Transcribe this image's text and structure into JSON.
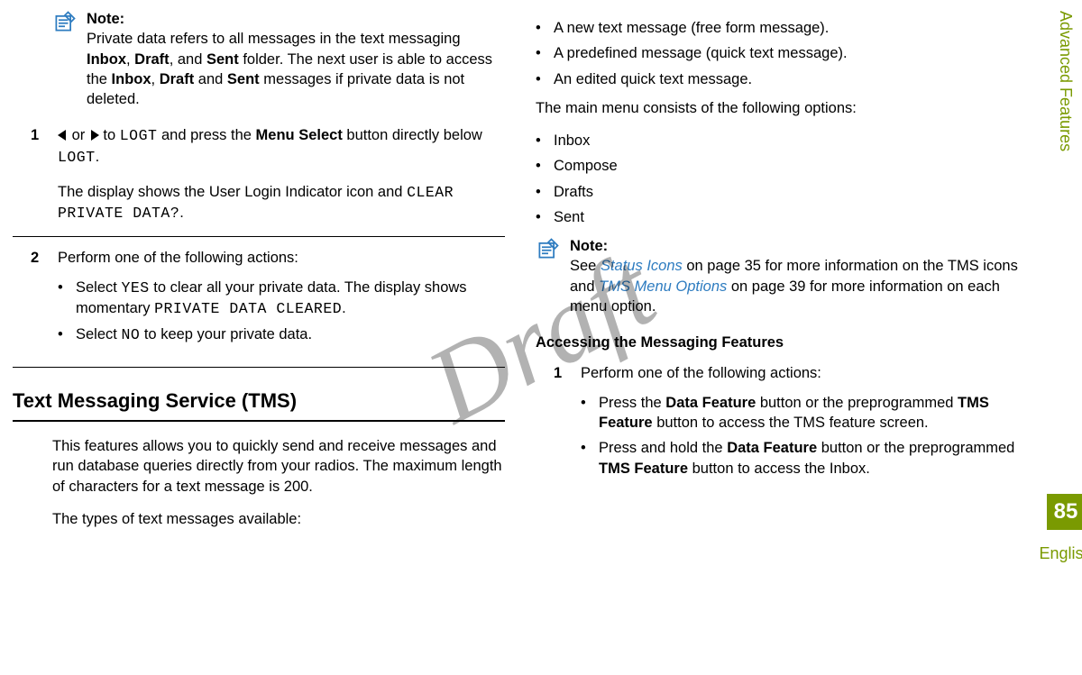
{
  "side": {
    "section": "Advanced Features",
    "page": "85",
    "lang": "English"
  },
  "watermark": "Draft",
  "left": {
    "note": {
      "title": "Note:",
      "textParts": {
        "a": "Private data refers to all messages in the text messaging ",
        "b1": "Inbox",
        "b2": ", ",
        "b3": "Draft",
        "b4": ", and ",
        "b5": "Sent",
        "c": " folder. The next user is able to access the ",
        "d1": "Inbox",
        "d2": ", ",
        "d3": "Draft",
        "d4": " and ",
        "d5": "Sent",
        "e": " messages if private data is not deleted."
      }
    },
    "step1": {
      "num": "1",
      "a": " or ",
      "b": " to ",
      "logt1": "LOGT",
      "c": " and press the ",
      "menu": "Menu Select",
      "d": " button directly below ",
      "logt2": "LOGT",
      "e": ".",
      "sub": {
        "a": "The display shows the User Login Indicator icon and ",
        "code": "CLEAR PRIVATE DATA?",
        "b": "."
      }
    },
    "step2": {
      "num": "2",
      "lead": "Perform one of the following actions:",
      "b1": {
        "a": "Select ",
        "yes": "YES",
        "b": " to clear all your private data. The display shows momentary ",
        "code": "PRIVATE DATA CLEARED",
        "c": "."
      },
      "b2": {
        "a": "Select ",
        "no": "NO",
        "b": " to keep your private data."
      }
    },
    "section": "Text Messaging Service (TMS)",
    "tms": {
      "p1": "This features allows you to quickly send and receive messages and run database queries directly from your radios. The maximum length of characters for a text message is 200.",
      "p2": "The types of text messages available:"
    }
  },
  "right": {
    "types": {
      "i1": "A new text message (free form message).",
      "i2": "A predefined message (quick text message).",
      "i3": "An edited quick text message."
    },
    "mainMenuLead": "The main menu consists of the following options:",
    "menu": {
      "i1": "Inbox",
      "i2": "Compose",
      "i3": "Drafts",
      "i4": "Sent"
    },
    "note": {
      "title": "Note:",
      "a": "See ",
      "link1": "Status Icons",
      "b": " on page 35 for more information on the TMS icons and ",
      "link2": "TMS Menu Options",
      "c": " on page 39 for more information on each menu option."
    },
    "subhead": "Accessing the Messaging Features",
    "step1": {
      "num": "1",
      "lead": "Perform one of the following actions:",
      "b1": {
        "a": "Press the ",
        "df": "Data Feature",
        "b": " button or the preprogrammed ",
        "tf": "TMS Feature",
        "c": " button to access the TMS feature screen."
      },
      "b2": {
        "a": "Press and hold the ",
        "df": "Data Feature",
        "b": " button or the preprogrammed ",
        "tf": "TMS Feature",
        "c": " button to access the Inbox."
      }
    }
  },
  "bullet": "•"
}
